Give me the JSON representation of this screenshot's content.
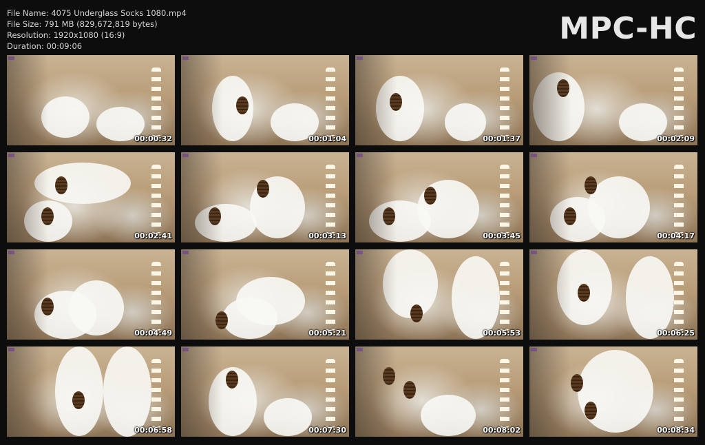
{
  "info": {
    "file_name": "File Name: 4075 Underglass Socks 1080.mp4",
    "file_size": "File Size: 791 MB (829,672,819 bytes)",
    "resolution": "Resolution: 1920x1080 (16:9)",
    "duration": "Duration: 00:09:06"
  },
  "logo": "MPC-HC",
  "thumbnails": [
    {
      "time": "00:00:32"
    },
    {
      "time": "00:01:04"
    },
    {
      "time": "00:01:37"
    },
    {
      "time": "00:02:09"
    },
    {
      "time": "00:02:41"
    },
    {
      "time": "00:03:13"
    },
    {
      "time": "00:03:45"
    },
    {
      "time": "00:04:17"
    },
    {
      "time": "00:04:49"
    },
    {
      "time": "00:05:21"
    },
    {
      "time": "00:05:53"
    },
    {
      "time": "00:06:25"
    },
    {
      "time": "00:06:58"
    },
    {
      "time": "00:07:30"
    },
    {
      "time": "00:08:02"
    },
    {
      "time": "00:08:34"
    }
  ]
}
